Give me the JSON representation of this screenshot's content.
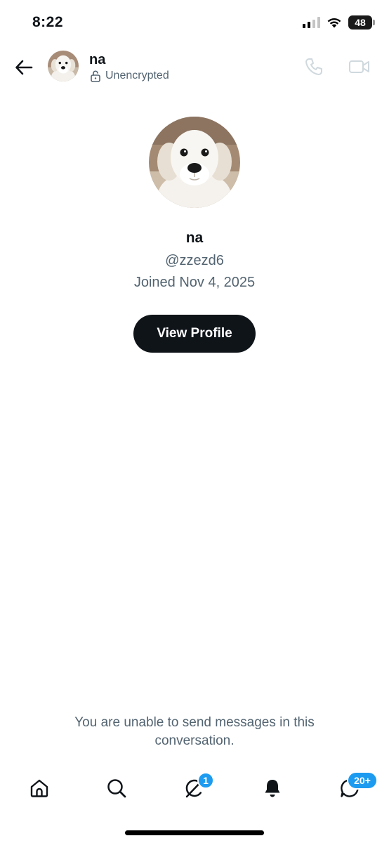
{
  "status_bar": {
    "time": "8:22",
    "battery": "48"
  },
  "header": {
    "name": "na",
    "encryption_label": "Unencrypted"
  },
  "profile": {
    "name": "na",
    "handle": "@zzezd6",
    "joined": "Joined Nov 4, 2025",
    "view_profile_label": "View Profile"
  },
  "notice": "You are unable to send messages in this conversation.",
  "bottom_nav": {
    "items": [
      {
        "name": "home",
        "icon": "home-icon"
      },
      {
        "name": "search",
        "icon": "search-icon"
      },
      {
        "name": "grok",
        "icon": "grok-icon",
        "badge": "1"
      },
      {
        "name": "notifications",
        "icon": "bell-icon"
      },
      {
        "name": "messages",
        "icon": "message-icon",
        "badge": "20+"
      }
    ]
  },
  "colors": {
    "text_primary": "#0f1419",
    "text_secondary": "#536471",
    "accent": "#1d9bf0",
    "button_bg": "#0f1419",
    "disabled_icon": "#cfd9de"
  }
}
